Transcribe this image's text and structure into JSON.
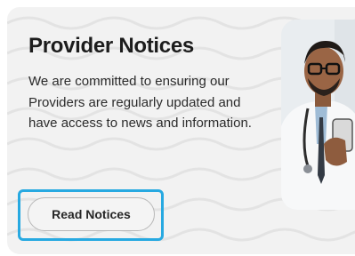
{
  "notice_card": {
    "title": "Provider Notices",
    "description": "We are committed to ensuring our Providers are regularly updated and have access to news and information.",
    "read_button_label": "Read Notices"
  },
  "colors": {
    "card_background": "#f2f2f2",
    "focus_ring": "#27a9e1",
    "title_text": "#1c1c1c"
  }
}
